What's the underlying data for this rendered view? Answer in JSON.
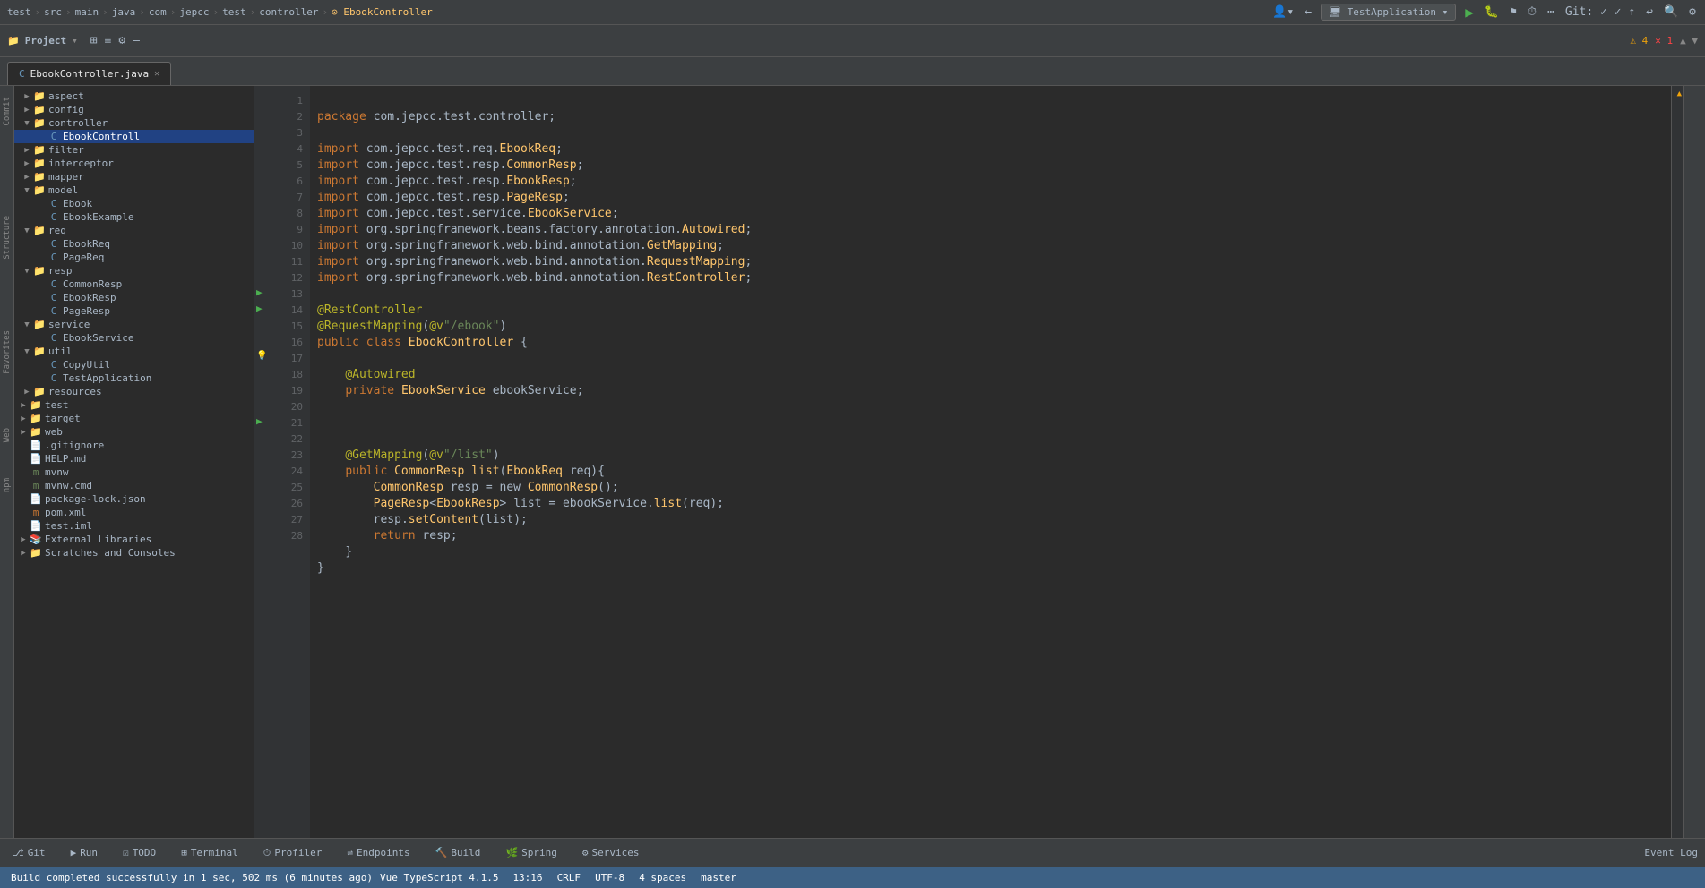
{
  "topbar": {
    "breadcrumb": [
      "test",
      "src",
      "main",
      "java",
      "com",
      "jepcc",
      "test",
      "controller",
      "EbookController"
    ],
    "run_config": "TestApplication",
    "git_label": "Git:",
    "branch": "master"
  },
  "toolbar": {
    "project_label": "Project",
    "warnings": "⚠ 4  ✕ 1"
  },
  "tabs": [
    {
      "label": "EbookController.java",
      "active": true
    }
  ],
  "project_tree": {
    "header": "Project",
    "items": [
      {
        "indent": 4,
        "arrow": "▶",
        "icon": "folder",
        "label": "aspect",
        "level": 1
      },
      {
        "indent": 4,
        "arrow": "▶",
        "icon": "folder",
        "label": "config",
        "level": 1
      },
      {
        "indent": 4,
        "arrow": "▼",
        "icon": "folder",
        "label": "controller",
        "level": 1
      },
      {
        "indent": 16,
        "arrow": "",
        "icon": "class",
        "label": "EbookControll",
        "level": 2,
        "selected": true
      },
      {
        "indent": 4,
        "arrow": "▶",
        "icon": "folder",
        "label": "filter",
        "level": 1
      },
      {
        "indent": 4,
        "arrow": "▶",
        "icon": "folder",
        "label": "interceptor",
        "level": 1
      },
      {
        "indent": 4,
        "arrow": "▶",
        "icon": "folder",
        "label": "mapper",
        "level": 1
      },
      {
        "indent": 4,
        "arrow": "▼",
        "icon": "folder",
        "label": "model",
        "level": 1
      },
      {
        "indent": 16,
        "arrow": "",
        "icon": "class",
        "label": "Ebook",
        "level": 2
      },
      {
        "indent": 16,
        "arrow": "",
        "icon": "class",
        "label": "EbookExample",
        "level": 2
      },
      {
        "indent": 4,
        "arrow": "▼",
        "icon": "folder",
        "label": "req",
        "level": 1
      },
      {
        "indent": 16,
        "arrow": "",
        "icon": "class",
        "label": "EbookReq",
        "level": 2
      },
      {
        "indent": 16,
        "arrow": "",
        "icon": "class",
        "label": "PageReq",
        "level": 2
      },
      {
        "indent": 4,
        "arrow": "▼",
        "icon": "folder",
        "label": "resp",
        "level": 1
      },
      {
        "indent": 16,
        "arrow": "",
        "icon": "class",
        "label": "CommonResp",
        "level": 2
      },
      {
        "indent": 16,
        "arrow": "",
        "icon": "class",
        "label": "EbookResp",
        "level": 2
      },
      {
        "indent": 16,
        "arrow": "",
        "icon": "class",
        "label": "PageResp",
        "level": 2
      },
      {
        "indent": 4,
        "arrow": "▼",
        "icon": "folder",
        "label": "service",
        "level": 1
      },
      {
        "indent": 16,
        "arrow": "",
        "icon": "class",
        "label": "EbookService",
        "level": 2
      },
      {
        "indent": 4,
        "arrow": "▼",
        "icon": "folder",
        "label": "util",
        "level": 1
      },
      {
        "indent": 16,
        "arrow": "",
        "icon": "class",
        "label": "CopyUtil",
        "level": 2
      },
      {
        "indent": 16,
        "arrow": "",
        "icon": "class",
        "label": "TestApplication",
        "level": 2
      },
      {
        "indent": 4,
        "arrow": "▶",
        "icon": "folder",
        "label": "resources",
        "level": 1
      },
      {
        "indent": 2,
        "arrow": "▶",
        "icon": "folder",
        "label": "test",
        "level": 0
      },
      {
        "indent": 2,
        "arrow": "▶",
        "icon": "folder",
        "label": "target",
        "level": 0
      },
      {
        "indent": 2,
        "arrow": "▶",
        "icon": "folder",
        "label": "web",
        "level": 0
      },
      {
        "indent": 2,
        "arrow": "",
        "icon": "file",
        "label": ".gitignore",
        "level": 0
      },
      {
        "indent": 2,
        "arrow": "",
        "icon": "file",
        "label": "HELP.md",
        "level": 0
      },
      {
        "indent": 2,
        "arrow": "",
        "icon": "file",
        "label": "mvnw",
        "level": 0
      },
      {
        "indent": 2,
        "arrow": "",
        "icon": "file",
        "label": "mvnw.cmd",
        "level": 0
      },
      {
        "indent": 2,
        "arrow": "",
        "icon": "file",
        "label": "package-lock.json",
        "level": 0
      },
      {
        "indent": 2,
        "arrow": "",
        "icon": "file",
        "label": "pom.xml",
        "level": 0
      },
      {
        "indent": 2,
        "arrow": "",
        "icon": "file",
        "label": "test.iml",
        "level": 0
      },
      {
        "indent": 2,
        "arrow": "▶",
        "icon": "folder",
        "label": "External Libraries",
        "level": 0
      },
      {
        "indent": 2,
        "arrow": "▶",
        "icon": "folder",
        "label": "Scratches and Consoles",
        "level": 0
      }
    ]
  },
  "code": {
    "lines": [
      {
        "num": 1,
        "content": "package com.jepcc.test.controller;"
      },
      {
        "num": 2,
        "content": ""
      },
      {
        "num": 3,
        "content": "import com.jepcc.test.req.EbookReq;"
      },
      {
        "num": 4,
        "content": "import com.jepcc.test.resp.CommonResp;"
      },
      {
        "num": 5,
        "content": "import com.jepcc.test.resp.EbookResp;"
      },
      {
        "num": 6,
        "content": "import com.jepcc.test.resp.PageResp;"
      },
      {
        "num": 7,
        "content": "import com.jepcc.test.service.EbookService;"
      },
      {
        "num": 8,
        "content": "import org.springframework.beans.factory.annotation.Autowired;"
      },
      {
        "num": 9,
        "content": "import org.springframework.web.bind.annotation.GetMapping;"
      },
      {
        "num": 10,
        "content": "import org.springframework.web.bind.annotation.RequestMapping;"
      },
      {
        "num": 11,
        "content": "import org.springframework.web.bind.annotation.RestController;"
      },
      {
        "num": 12,
        "content": ""
      },
      {
        "num": 13,
        "content": "@RestController"
      },
      {
        "num": 14,
        "content": "@RequestMapping(@v\"/ebook\")"
      },
      {
        "num": 15,
        "content": "public class EbookController {"
      },
      {
        "num": 16,
        "content": ""
      },
      {
        "num": 17,
        "content": "    @Autowired"
      },
      {
        "num": 18,
        "content": "    private EbookService ebookService;"
      },
      {
        "num": 19,
        "content": ""
      },
      {
        "num": 20,
        "content": ""
      },
      {
        "num": 21,
        "content": "    @GetMapping(@v\"/list\")"
      },
      {
        "num": 22,
        "content": "    public CommonResp list(EbookReq req){"
      },
      {
        "num": 23,
        "content": "        CommonResp resp = new CommonResp();"
      },
      {
        "num": 24,
        "content": "        PageResp<EbookResp> list = ebookService.list(req);"
      },
      {
        "num": 25,
        "content": "        resp.setContent(list);"
      },
      {
        "num": 26,
        "content": "        return resp;"
      },
      {
        "num": 27,
        "content": "    }"
      },
      {
        "num": 28,
        "content": "}"
      }
    ]
  },
  "bottom_tabs": [
    {
      "label": "Git",
      "icon": "git-icon",
      "active": false
    },
    {
      "label": "Run",
      "icon": "run-icon",
      "active": false
    },
    {
      "label": "TODO",
      "icon": "todo-icon",
      "active": false
    },
    {
      "label": "Terminal",
      "icon": "terminal-icon",
      "active": false
    },
    {
      "label": "Profiler",
      "icon": "profiler-icon",
      "active": false
    },
    {
      "label": "Endpoints",
      "icon": "endpoints-icon",
      "active": false
    },
    {
      "label": "Build",
      "icon": "build-icon",
      "active": false
    },
    {
      "label": "Spring",
      "icon": "spring-icon",
      "active": false
    },
    {
      "label": "Services",
      "icon": "services-icon",
      "active": false
    }
  ],
  "status_bar": {
    "message": "Build completed successfully in 1 sec, 502 ms (6 minutes ago)",
    "type_info": "Vue TypeScript 4.1.5",
    "position": "13:16",
    "line_sep": "CRLF",
    "encoding": "UTF-8",
    "indent": "4 spaces",
    "branch": "master",
    "event_log": "Event Log"
  }
}
